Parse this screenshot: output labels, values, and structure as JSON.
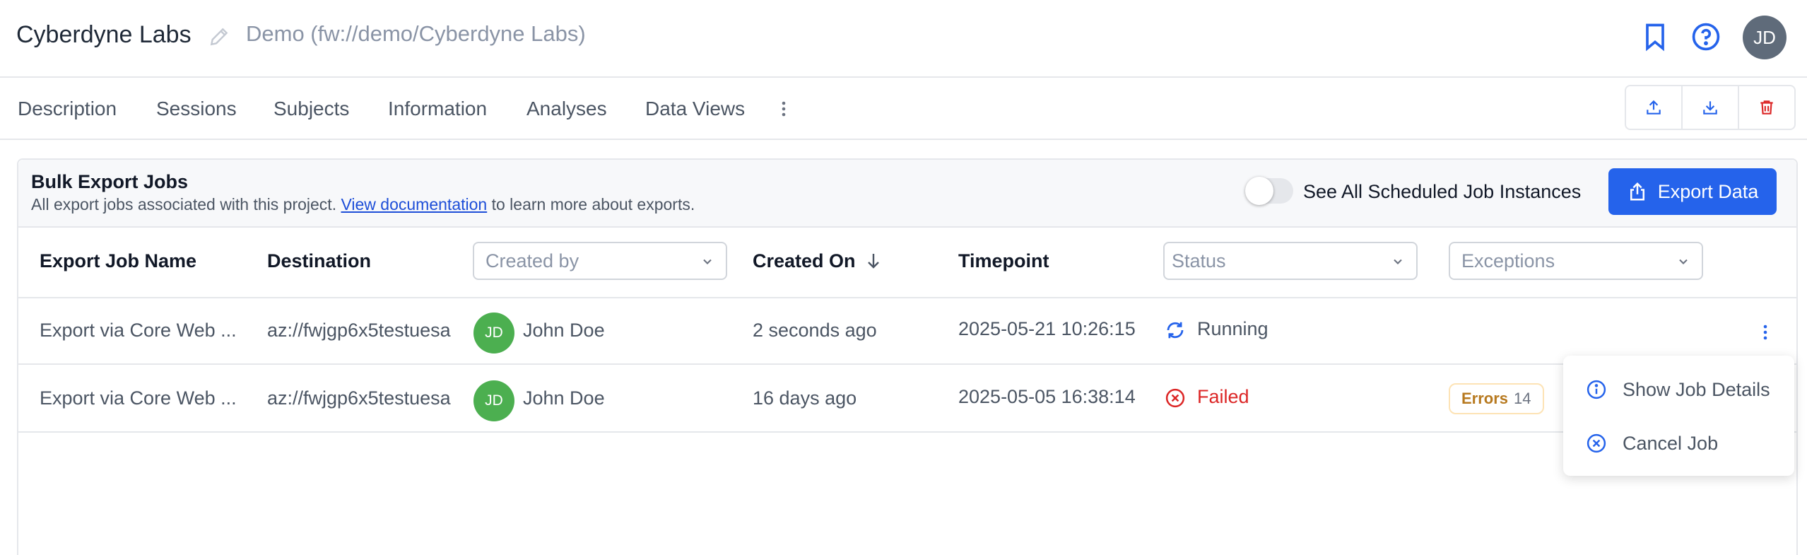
{
  "header": {
    "project_title": "Cyberdyne Labs",
    "project_path": "Demo (fw://demo/Cyberdyne Labs)",
    "avatar_initials": "JD"
  },
  "tabs": [
    {
      "label": "Description"
    },
    {
      "label": "Sessions"
    },
    {
      "label": "Subjects"
    },
    {
      "label": "Information"
    },
    {
      "label": "Analyses"
    },
    {
      "label": "Data Views"
    }
  ],
  "panel": {
    "title": "Bulk Export Jobs",
    "desc_prefix": "All export jobs associated with this project.",
    "doc_link": "View documentation",
    "desc_suffix": "to learn more about exports.",
    "toggle_label": "See All Scheduled Job Instances",
    "toggle_on": false,
    "export_button": "Export Data"
  },
  "table": {
    "columns": {
      "name": "Export Job Name",
      "destination": "Destination",
      "created_by_placeholder": "Created by",
      "created_on": "Created On",
      "timepoint": "Timepoint",
      "status_placeholder": "Status",
      "exceptions_placeholder": "Exceptions"
    },
    "rows": [
      {
        "name": "Export via Core Web ...",
        "destination": "az://fwjgp6x5testuesa",
        "user_initials": "JD",
        "user": "John Doe",
        "created_on": "2 seconds ago",
        "timepoint": "2025-05-21 10:26:15",
        "status": "Running",
        "status_color": "#4b5563",
        "status_icon": "refresh-icon"
      },
      {
        "name": "Export via Core Web ...",
        "destination": "az://fwjgp6x5testuesa",
        "user_initials": "JD",
        "user": "John Doe",
        "created_on": "16 days ago",
        "timepoint": "2025-05-05 16:38:14",
        "status": "Failed",
        "status_color": "#dc2626",
        "status_icon": "x-circle-icon",
        "exception_label": "Errors",
        "exception_count": "14"
      }
    ]
  },
  "context_menu": {
    "items": [
      {
        "label": "Show Job Details",
        "icon": "info-icon"
      },
      {
        "label": "Cancel Job",
        "icon": "x-circle-icon"
      }
    ]
  },
  "colors": {
    "accent": "#2563eb",
    "danger": "#dc2626",
    "warning_text": "#b7791f",
    "user_avatar": "#4caf50"
  }
}
